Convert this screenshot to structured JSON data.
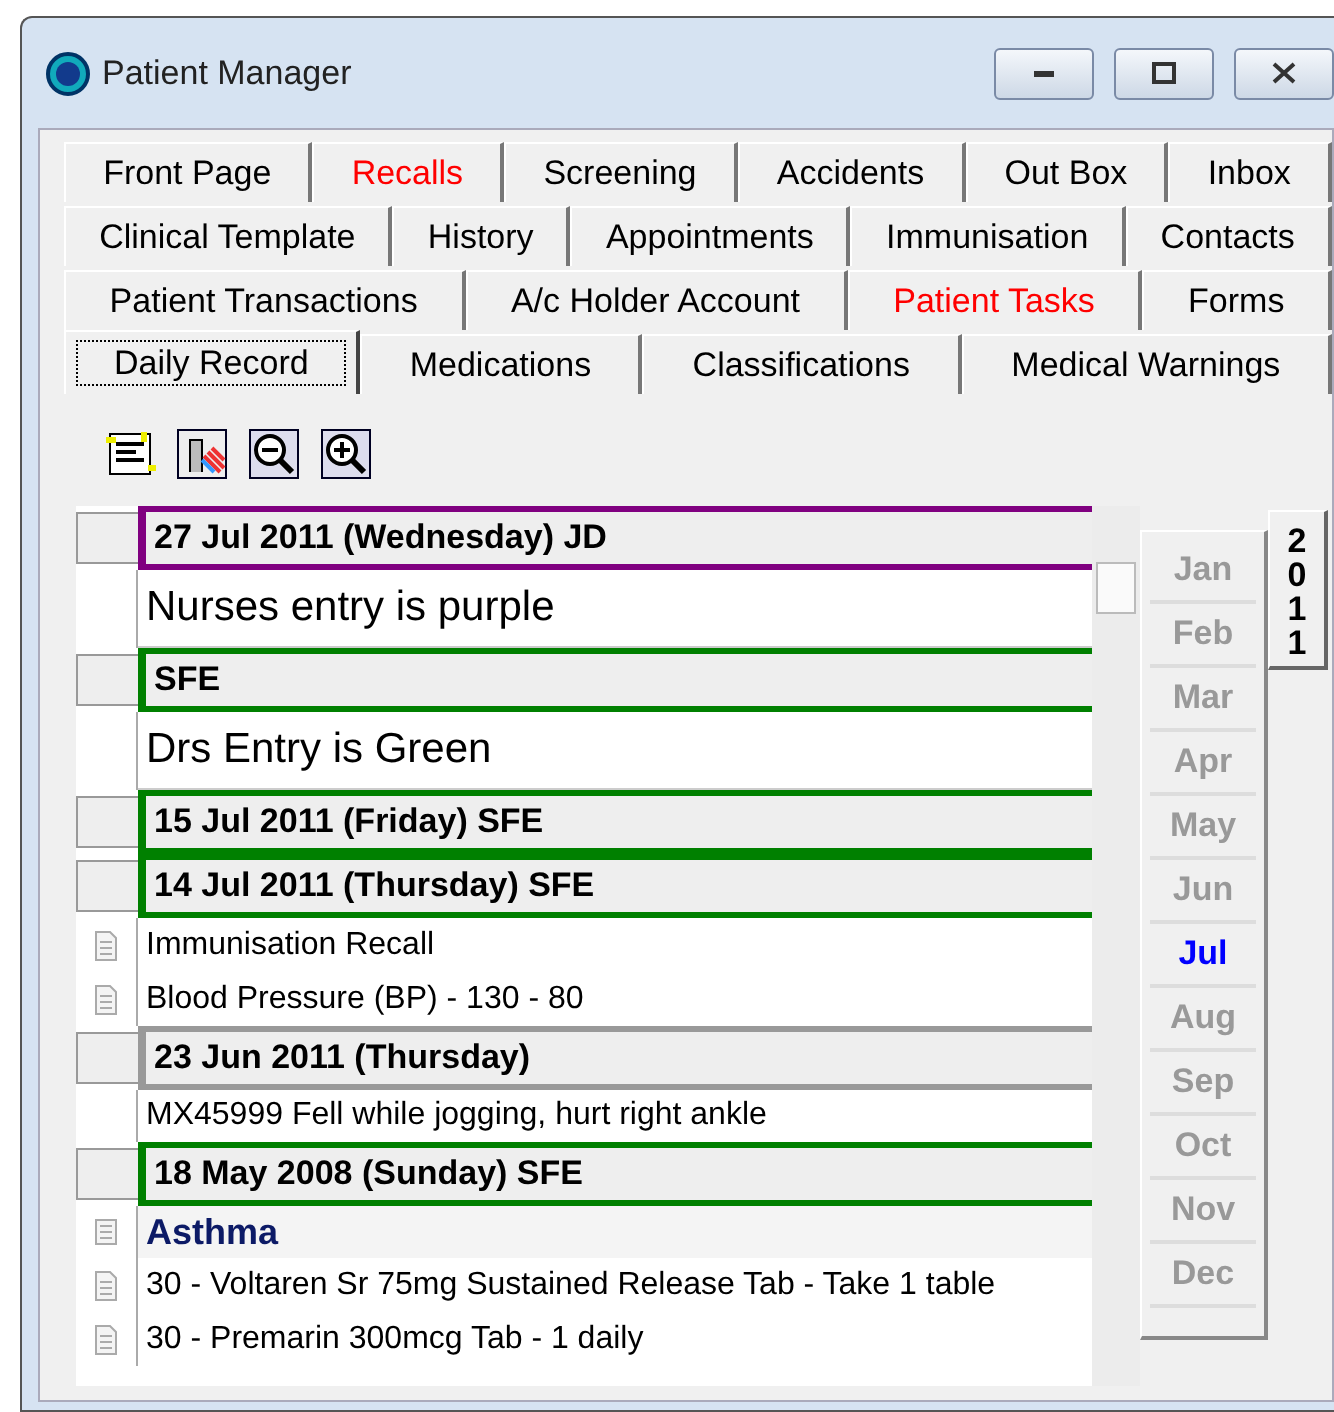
{
  "window": {
    "title": "Patient Manager"
  },
  "tab_rows": [
    [
      {
        "label": "Front Page",
        "selected": false,
        "alert": false
      },
      {
        "label": "Recalls",
        "selected": false,
        "alert": true
      },
      {
        "label": "Screening",
        "selected": false,
        "alert": false
      },
      {
        "label": "Accidents",
        "selected": false,
        "alert": false
      },
      {
        "label": "Out Box",
        "selected": false,
        "alert": false
      },
      {
        "label": "Inbox",
        "selected": false,
        "alert": false
      }
    ],
    [
      {
        "label": "Clinical Template",
        "selected": false,
        "alert": false
      },
      {
        "label": "History",
        "selected": false,
        "alert": false
      },
      {
        "label": "Appointments",
        "selected": false,
        "alert": false
      },
      {
        "label": "Immunisation",
        "selected": false,
        "alert": false
      },
      {
        "label": "Contacts",
        "selected": false,
        "alert": false
      }
    ],
    [
      {
        "label": "Patient Transactions",
        "selected": false,
        "alert": false
      },
      {
        "label": "A/c Holder Account",
        "selected": false,
        "alert": false
      },
      {
        "label": "Patient Tasks",
        "selected": false,
        "alert": true
      },
      {
        "label": "Forms",
        "selected": false,
        "alert": false
      }
    ],
    [
      {
        "label": "Daily Record",
        "selected": true,
        "alert": false
      },
      {
        "label": "Medications",
        "selected": false,
        "alert": false
      },
      {
        "label": "Classifications",
        "selected": false,
        "alert": false
      },
      {
        "label": "Medical Warnings",
        "selected": false,
        "alert": false
      }
    ]
  ],
  "records": [
    {
      "kind": "header",
      "text": "27 Jul 2011 (Wednesday) JD",
      "color": "#800080"
    },
    {
      "kind": "note",
      "text": "Nurses entry is purple"
    },
    {
      "kind": "header",
      "text": "SFE",
      "color": "#008000"
    },
    {
      "kind": "note",
      "text": "Drs Entry is Green"
    },
    {
      "kind": "header",
      "text": "15 Jul 2011 (Friday) SFE",
      "color": "#008000"
    },
    {
      "kind": "header",
      "text": "14 Jul 2011 (Thursday) SFE",
      "color": "#008000"
    },
    {
      "kind": "item",
      "text": "Immunisation Recall"
    },
    {
      "kind": "item",
      "text": "Blood Pressure (BP) - 130 - 80"
    },
    {
      "kind": "header",
      "text": "23 Jun 2011 (Thursday)"
    },
    {
      "kind": "plain",
      "text": "MX45999  Fell while jogging, hurt right ankle"
    },
    {
      "kind": "header",
      "text": "18 May 2008 (Sunday) SFE",
      "color": "#008000"
    },
    {
      "kind": "category",
      "text": "Asthma"
    },
    {
      "kind": "item",
      "text": "30 - Voltaren Sr 75mg Sustained Release Tab - Take 1 table"
    },
    {
      "kind": "item",
      "text": "30 - Premarin 300mcg Tab - 1 daily"
    }
  ],
  "calendar": {
    "year": "2011",
    "year_selected": true,
    "months": [
      {
        "label": "Jan",
        "selected": false
      },
      {
        "label": "Feb",
        "selected": false
      },
      {
        "label": "Mar",
        "selected": false
      },
      {
        "label": "Apr",
        "selected": false
      },
      {
        "label": "May",
        "selected": false
      },
      {
        "label": "Jun",
        "selected": false
      },
      {
        "label": "Jul",
        "selected": true
      },
      {
        "label": "Aug",
        "selected": false
      },
      {
        "label": "Sep",
        "selected": false
      },
      {
        "label": "Oct",
        "selected": false
      },
      {
        "label": "Nov",
        "selected": false
      },
      {
        "label": "Dec",
        "selected": false
      }
    ]
  }
}
